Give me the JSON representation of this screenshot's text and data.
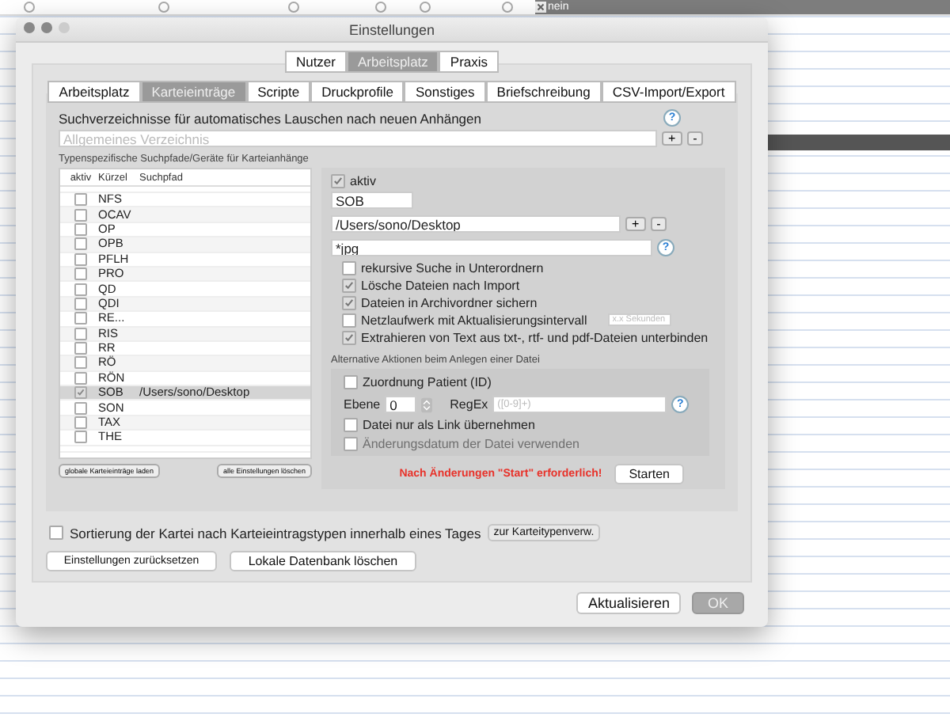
{
  "background_table": {
    "radios": [
      {
        "selected": false
      },
      {
        "selected": false
      },
      {
        "selected": false
      },
      {
        "selected": false
      },
      {
        "selected": false
      },
      {
        "selected": false
      }
    ],
    "value": "nein"
  },
  "window": {
    "title": "Einstellungen"
  },
  "segments": [
    {
      "label": "Nutzer",
      "selected": false
    },
    {
      "label": "Arbeitsplatz",
      "selected": true
    },
    {
      "label": "Praxis",
      "selected": false
    }
  ],
  "tabs": [
    {
      "label": "Arbeitsplatz",
      "selected": false
    },
    {
      "label": "Karteieinträge",
      "selected": true
    },
    {
      "label": "Scripte",
      "selected": false
    },
    {
      "label": "Druckprofile",
      "selected": false
    },
    {
      "label": "Sonstiges",
      "selected": false
    },
    {
      "label": "Briefschreibung",
      "selected": false
    },
    {
      "label": "CSV-Import/Export",
      "selected": false
    }
  ],
  "search_dirs": {
    "label": "Suchverzeichnisse für automatisches Lauschen nach neuen Anhängen",
    "placeholder": "Allgemeines Verzeichnis",
    "help": "?",
    "add": "+",
    "remove": "-"
  },
  "list": {
    "caption": "Typenspezifische Suchpfade/Geräte für Karteianhänge",
    "columns": [
      "aktiv",
      "Kürzel",
      "Suchpfad"
    ],
    "rows": [
      {
        "checked": false,
        "code": "NFS",
        "path": "",
        "selected": false
      },
      {
        "checked": false,
        "code": "OCAV",
        "path": "",
        "selected": false
      },
      {
        "checked": false,
        "code": "OP",
        "path": "",
        "selected": false
      },
      {
        "checked": false,
        "code": "OPB",
        "path": "",
        "selected": false
      },
      {
        "checked": false,
        "code": "PFLH",
        "path": "",
        "selected": false
      },
      {
        "checked": false,
        "code": "PRO",
        "path": "",
        "selected": false
      },
      {
        "checked": false,
        "code": "QD",
        "path": "",
        "selected": false
      },
      {
        "checked": false,
        "code": "QDI",
        "path": "",
        "selected": false
      },
      {
        "checked": false,
        "code": "RE...",
        "path": "",
        "selected": false
      },
      {
        "checked": false,
        "code": "RIS",
        "path": "",
        "selected": false
      },
      {
        "checked": false,
        "code": "RR",
        "path": "",
        "selected": false
      },
      {
        "checked": false,
        "code": "RÖ",
        "path": "",
        "selected": false
      },
      {
        "checked": false,
        "code": "RÖN",
        "path": "",
        "selected": false
      },
      {
        "checked": true,
        "code": "SOB",
        "path": "/Users/sono/Desktop",
        "selected": true
      },
      {
        "checked": false,
        "code": "SON",
        "path": "",
        "selected": false
      },
      {
        "checked": false,
        "code": "TAX",
        "path": "",
        "selected": false
      },
      {
        "checked": false,
        "code": "THE",
        "path": "",
        "selected": false
      }
    ],
    "buttons": [
      "globale Karteieinträge laden",
      "alle Einstellungen löschen"
    ]
  },
  "detail": {
    "active": {
      "label": "aktiv",
      "checked": true
    },
    "code": "SOB",
    "path": "/Users/sono/Desktop",
    "add": "+",
    "remove": "-",
    "pattern": "*jpg",
    "help": "?",
    "options": [
      {
        "label": "rekursive Suche in Unterordnern",
        "checked": false
      },
      {
        "label": "Lösche Dateien nach Import",
        "checked": true
      },
      {
        "label": "Dateien in Archivordner sichern",
        "checked": true
      },
      {
        "label": "Netzlaufwerk mit Aktualisierungsintervall",
        "checked": false,
        "placeholder": "x.x Sekunden"
      },
      {
        "label": "Extrahieren von Text aus txt-, rtf- und pdf-Dateien unterbinden",
        "checked": true
      }
    ],
    "alt_caption": "Alternative Aktionen beim Anlegen einer Datei",
    "alt": {
      "assign": {
        "label": "Zuordnung Patient (ID)",
        "checked": false
      },
      "level_label": "Ebene",
      "level": "0",
      "regex_label": "RegEx",
      "regex_placeholder": "([0-9]+)",
      "help": "?",
      "link": {
        "label": "Datei nur als Link übernehmen",
        "checked": false
      },
      "date": {
        "label": "Änderungsdatum der Datei verwenden",
        "checked": false,
        "disabled": true
      }
    },
    "warning": "Nach Änderungen \"Start\" erforderlich!",
    "start": "Starten"
  },
  "sort": {
    "label": "Sortierung der Kartei nach Karteieintragstypen innerhalb eines Tages",
    "checked": false,
    "button": "zur Karteitypenverw."
  },
  "buttons": [
    "Einstellungen zurücksetzen",
    "Lokale Datenbank löschen"
  ],
  "footer_buttons": [
    {
      "label": "Aktualisieren",
      "disabled": false
    },
    {
      "label": "OK",
      "disabled": true
    }
  ]
}
